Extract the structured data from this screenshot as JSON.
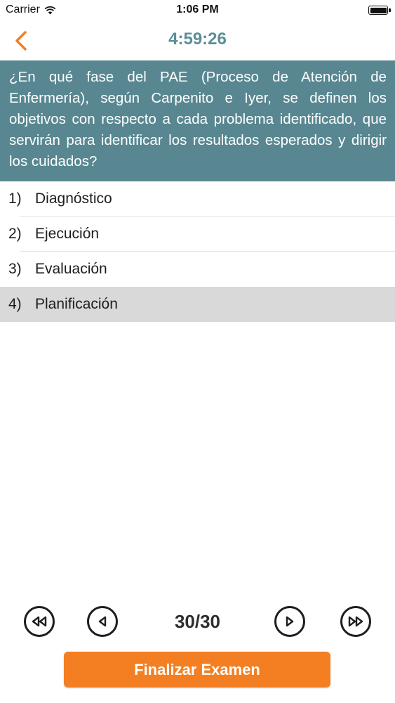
{
  "status_bar": {
    "carrier": "Carrier",
    "time": "1:06 PM"
  },
  "nav": {
    "timer": "4:59:26",
    "back_icon": "chevron-left-icon"
  },
  "question": {
    "text": "¿En qué fase del PAE (Proceso de Atención de Enfermería), según Carpenito e Iyer, se definen los objetivos con respecto a cada problema identificado, que servirán para identificar los resultados esperados y dirigir los cuidados?"
  },
  "answers": [
    {
      "number": "1)",
      "label": "Diagnóstico",
      "selected": false
    },
    {
      "number": "2)",
      "label": "Ejecución",
      "selected": false
    },
    {
      "number": "3)",
      "label": "Evaluación",
      "selected": false
    },
    {
      "number": "4)",
      "label": "Planificación",
      "selected": true
    }
  ],
  "pager": {
    "indicator": "30/30",
    "first_icon": "rewind-icon",
    "prev_icon": "previous-icon",
    "next_icon": "next-icon",
    "last_icon": "fast-forward-icon"
  },
  "finish_button": {
    "label": "Finalizar Examen"
  },
  "colors": {
    "accent": "#f37f22",
    "question_bg": "#588791",
    "timer": "#5b8e98",
    "selected_row": "#d9d9d9"
  }
}
